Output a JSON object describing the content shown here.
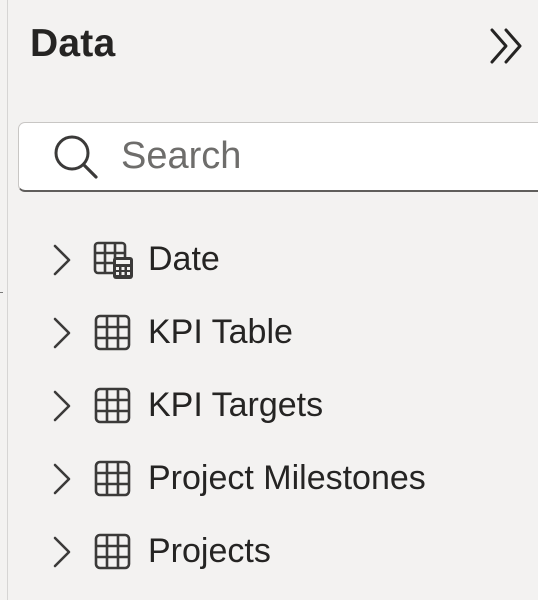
{
  "pane": {
    "title": "Data",
    "collapse_icon": "double-chevron-right-icon"
  },
  "search": {
    "placeholder": "Search",
    "value": ""
  },
  "tables": [
    {
      "label": "Date",
      "icon": "date-table-icon"
    },
    {
      "label": "KPI Table",
      "icon": "table-icon"
    },
    {
      "label": "KPI Targets",
      "icon": "table-icon"
    },
    {
      "label": "Project Milestones",
      "icon": "table-icon"
    },
    {
      "label": "Projects",
      "icon": "table-icon"
    }
  ]
}
